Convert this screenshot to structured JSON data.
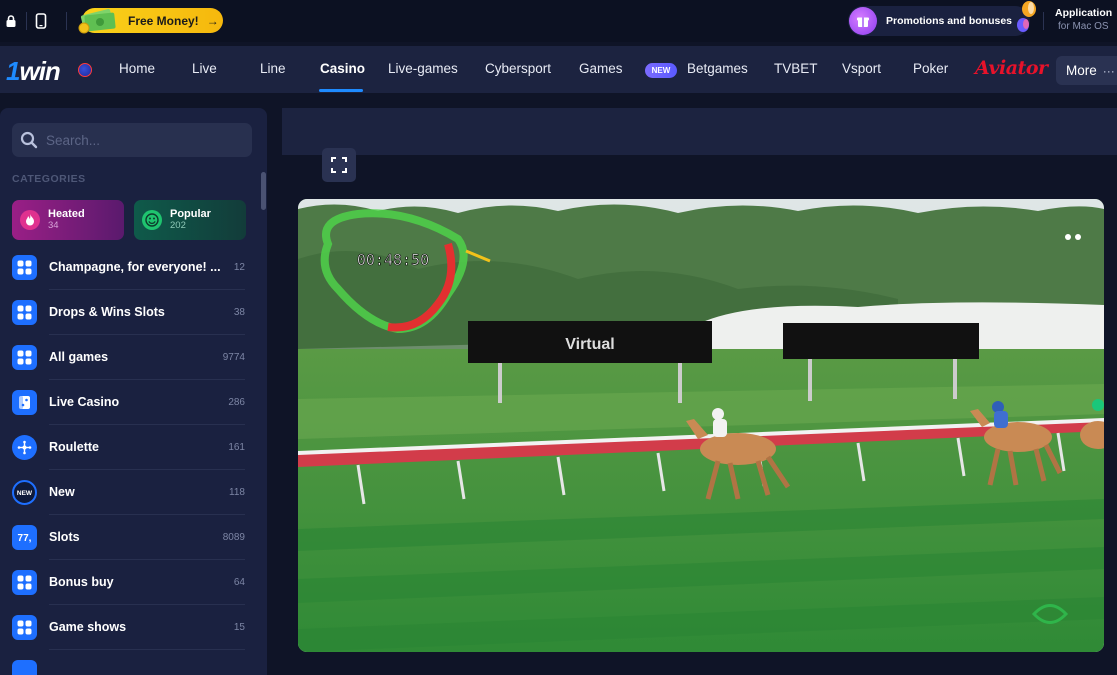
{
  "topbar": {
    "free_money_label": "Free Money!",
    "free_money_arrow": "→",
    "promo_label": "Promotions and bonuses",
    "app_title": "Application",
    "app_subtitle": "for Mac OS"
  },
  "nav": {
    "logo_one": "1",
    "logo_win": "win",
    "items": [
      "Home",
      "Live",
      "Line",
      "Casino",
      "Live-games",
      "Cybersport",
      "Games",
      "Betgames",
      "TVBET",
      "Vsport",
      "Poker"
    ],
    "active": "Casino",
    "new_badge": "NEW",
    "aviator": "Aviator",
    "more": "More",
    "more_dots": "···"
  },
  "sidebar": {
    "search_placeholder": "Search...",
    "categories_title": "CATEGORIES",
    "chips": [
      {
        "label": "Heated",
        "count": "34"
      },
      {
        "label": "Popular",
        "count": "202"
      }
    ],
    "items": [
      {
        "label": "Champagne, for everyone! ...",
        "count": "12",
        "icon": "grid-icon"
      },
      {
        "label": "Drops & Wins Slots",
        "count": "38",
        "icon": "grid-icon"
      },
      {
        "label": "All games",
        "count": "9774",
        "icon": "grid-icon"
      },
      {
        "label": "Live Casino",
        "count": "286",
        "icon": "dice-icon"
      },
      {
        "label": "Roulette",
        "count": "161",
        "icon": "roulette-icon"
      },
      {
        "label": "New",
        "count": "118",
        "icon": "new-icon"
      },
      {
        "label": "Slots",
        "count": "8089",
        "icon": "slots-icon"
      },
      {
        "label": "Bonus buy",
        "count": "64",
        "icon": "grid-icon"
      },
      {
        "label": "Game shows",
        "count": "15",
        "icon": "grid-icon"
      }
    ]
  },
  "video": {
    "timer": "00:48:50",
    "billboard_text": "Virtual",
    "colors": {
      "track": "#3f8a3a",
      "rail": "#d23c4a",
      "sky": "#e6ece8"
    }
  },
  "colors": {
    "accent": "#1e8bff",
    "nav_bg": "#1c2340",
    "page_bg": "#0f1427"
  }
}
